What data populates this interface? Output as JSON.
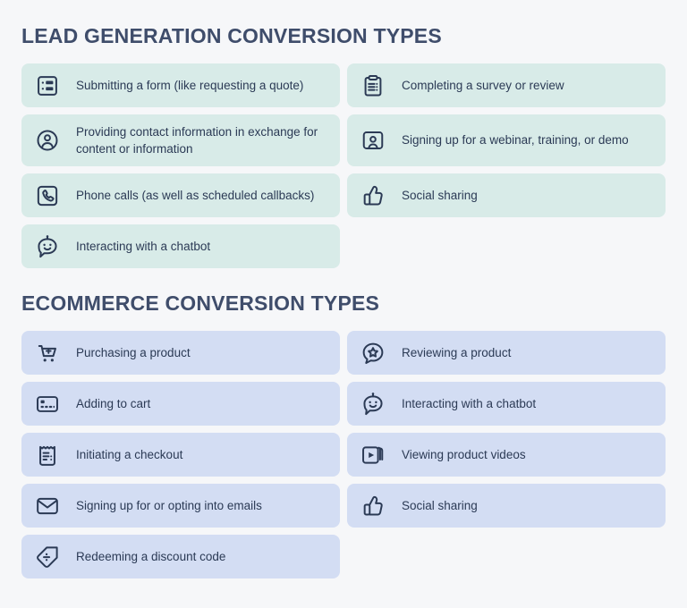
{
  "colors": {
    "background": "#f6f7f9",
    "heading": "#3f4d6b",
    "text": "#2b3a55",
    "lead_card": "#d8ebe8",
    "ecommerce_card": "#d3ddf3"
  },
  "sections": [
    {
      "id": "lead-generation",
      "title": "LEAD GENERATION CONVERSION TYPES",
      "theme": "teal",
      "items": [
        {
          "icon": "form-icon",
          "label": "Submitting a form (like requesting a quote)"
        },
        {
          "icon": "clipboard-icon",
          "label": "Completing a survey or review"
        },
        {
          "icon": "user-circle-icon",
          "label": "Providing contact information in exchange for content or information"
        },
        {
          "icon": "user-card-icon",
          "label": "Signing up for a webinar, training, or demo"
        },
        {
          "icon": "phone-icon",
          "label": "Phone calls (as well as scheduled callbacks)"
        },
        {
          "icon": "thumbs-up-icon",
          "label": "Social sharing"
        },
        {
          "icon": "chatbot-icon",
          "label": "Interacting with a chatbot"
        }
      ]
    },
    {
      "id": "ecommerce",
      "title": "ECOMMERCE CONVERSION TYPES",
      "theme": "blue",
      "items": [
        {
          "icon": "cart-plus-icon",
          "label": "Purchasing a product"
        },
        {
          "icon": "review-star-bubble-icon",
          "label": "Reviewing a product"
        },
        {
          "icon": "credit-card-icon",
          "label": "Adding to cart"
        },
        {
          "icon": "chatbot-icon",
          "label": "Interacting with a chatbot"
        },
        {
          "icon": "receipt-icon",
          "label": "Initiating a checkout"
        },
        {
          "icon": "video-play-icon",
          "label": "Viewing product videos"
        },
        {
          "icon": "envelope-icon",
          "label": "Signing up for or opting into emails"
        },
        {
          "icon": "thumbs-up-icon",
          "label": "Social sharing"
        },
        {
          "icon": "discount-tag-icon",
          "label": "Redeeming a discount code"
        }
      ]
    }
  ]
}
